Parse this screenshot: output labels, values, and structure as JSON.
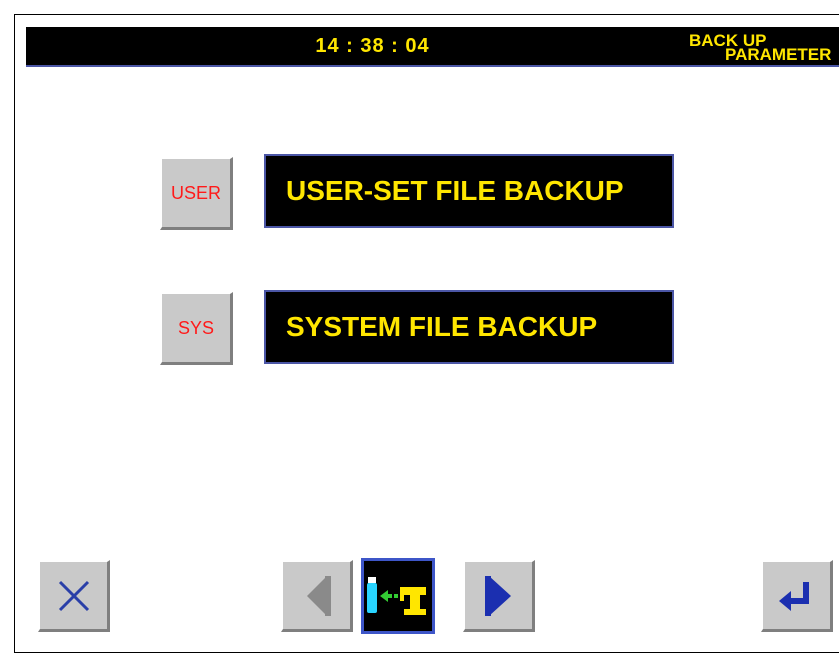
{
  "header": {
    "clock": "14 : 38 : 04",
    "mode_line1": "BACK UP",
    "mode_line2": "PARAMETER"
  },
  "options": [
    {
      "key_label": "USER",
      "description": "USER-SET FILE BACKUP"
    },
    {
      "key_label": "SYS",
      "description": "SYSTEM FILE BACKUP"
    }
  ],
  "bottom_bar": {
    "icons": [
      "close-icon",
      "arrow-left-icon",
      "usb-to-machine-icon",
      "arrow-right-icon",
      "enter-icon"
    ]
  },
  "colors": {
    "title_bg": "#000000",
    "title_text": "#ffe600",
    "key_text": "#ff1a1a",
    "box_border": "#4b56a6",
    "button_face": "#c9c9c9"
  }
}
